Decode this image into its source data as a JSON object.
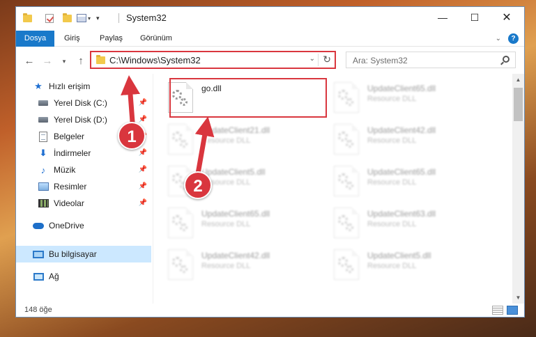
{
  "window": {
    "title": "System32"
  },
  "ribbon": {
    "tabs": [
      "Dosya",
      "Giriş",
      "Paylaş",
      "Görünüm"
    ],
    "help": "?"
  },
  "address": {
    "path": "C:\\Windows\\System32"
  },
  "search": {
    "placeholder": "Ara: System32"
  },
  "nav": {
    "items": [
      {
        "label": "Hızlı erişim",
        "icon": "star-icon"
      },
      {
        "label": "Yerel Disk (C:)",
        "icon": "drive-icon"
      },
      {
        "label": "Yerel Disk (D:)",
        "icon": "drive-icon"
      },
      {
        "label": "Belgeler",
        "icon": "document-icon"
      },
      {
        "label": "İndirmeler",
        "icon": "download-icon"
      },
      {
        "label": "Müzik",
        "icon": "music-icon"
      },
      {
        "label": "Resimler",
        "icon": "picture-icon"
      },
      {
        "label": "Videolar",
        "icon": "video-icon"
      },
      {
        "label": "OneDrive",
        "icon": "cloud-icon"
      },
      {
        "label": "Bu bilgisayar",
        "icon": "computer-icon"
      },
      {
        "label": "Ağ",
        "icon": "network-icon"
      }
    ]
  },
  "files": [
    {
      "name": "go.dll",
      "type": ""
    },
    {
      "name": "UpdateClient65.dll",
      "type": "Resource DLL"
    },
    {
      "name": "UpdateClient21.dll",
      "type": "Resource DLL"
    },
    {
      "name": "UpdateClient42.dll",
      "type": "Resource DLL"
    },
    {
      "name": "UpdateClient5.dll",
      "type": "Resource DLL"
    },
    {
      "name": "UpdateClient65.dll",
      "type": "Resource DLL"
    },
    {
      "name": "UpdateClient65.dll",
      "type": "Resource DLL"
    },
    {
      "name": "UpdateClient63.dll",
      "type": "Resource DLL"
    },
    {
      "name": "UpdateClient42.dll",
      "type": "Resource DLL"
    },
    {
      "name": "UpdateClient5.dll",
      "type": "Resource DLL"
    }
  ],
  "status": {
    "count": "148 öğe"
  },
  "annotations": {
    "step1": "1",
    "step2": "2"
  },
  "colors": {
    "accent": "#1979ca",
    "highlight": "#d9363e",
    "selected": "#cce8ff"
  }
}
